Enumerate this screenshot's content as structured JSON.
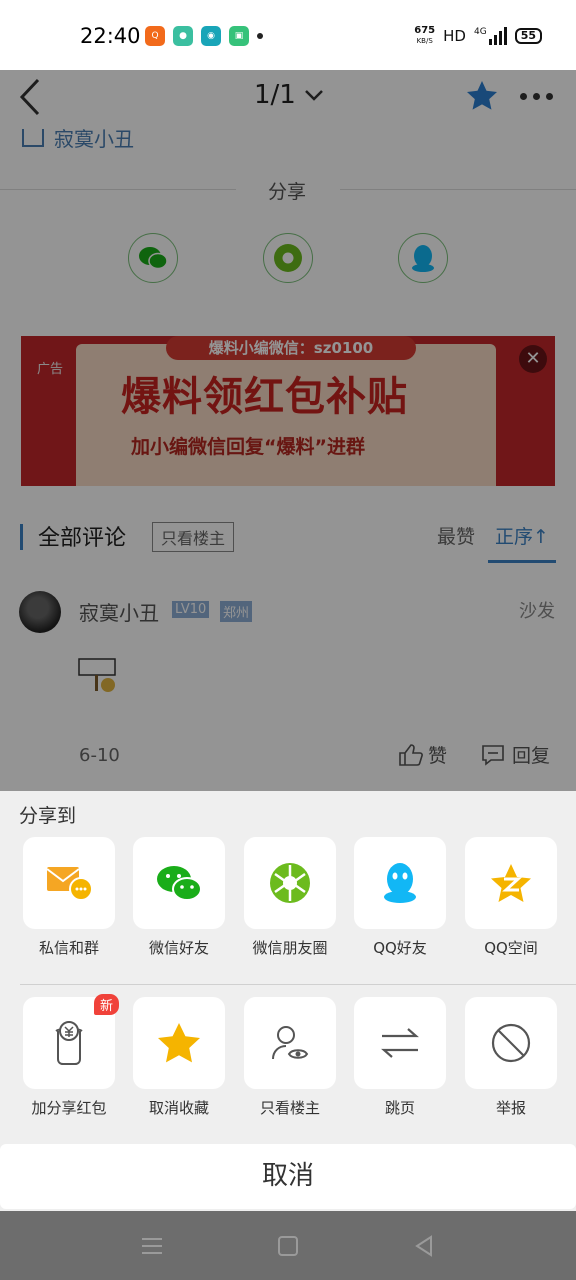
{
  "status_bar": {
    "time": "22:40",
    "net_speed": "675",
    "net_unit": "KB/S",
    "hd": "HD",
    "network": "4G",
    "battery": "55"
  },
  "app_bar": {
    "page_indicator": "1/1"
  },
  "post": {
    "author_snippet": "寂寞小丑",
    "share_title": "分享"
  },
  "ad": {
    "label": "广告",
    "pill": "爆料小编微信：sz0100",
    "headline": "爆料领红包补贴",
    "subline": "加小编微信回复“爆料”进群",
    "close": "✕"
  },
  "comments": {
    "title": "全部评论",
    "filter_tag": "只看楼主",
    "sort_hot": "最赞",
    "sort_order": "正序↑",
    "items": [
      {
        "name": "寂寞小丑",
        "level": "LV10",
        "location": "郑州",
        "floor": "沙发",
        "date": "6-10",
        "like": "赞",
        "reply": "回复"
      }
    ]
  },
  "share_sheet": {
    "title": "分享到",
    "row1": [
      {
        "label": "私信和群",
        "icon": "envelope-chat-icon"
      },
      {
        "label": "微信好友",
        "icon": "wechat-icon"
      },
      {
        "label": "微信朋友圈",
        "icon": "moments-icon"
      },
      {
        "label": "QQ好友",
        "icon": "qq-icon"
      },
      {
        "label": "QQ空间",
        "icon": "qzone-icon"
      }
    ],
    "row2": [
      {
        "label": "加分享红包",
        "icon": "red-packet-icon",
        "badge": "新"
      },
      {
        "label": "取消收藏",
        "icon": "star-icon"
      },
      {
        "label": "只看楼主",
        "icon": "eye-person-icon"
      },
      {
        "label": "跳页",
        "icon": "swap-arrows-icon"
      },
      {
        "label": "举报",
        "icon": "prohibit-icon"
      }
    ],
    "cancel": "取消"
  },
  "colors": {
    "accent": "#3b82c4",
    "wechat": "#1aad19",
    "qq": "#12b7f5",
    "qzone": "#f5b400",
    "star": "#f5b400",
    "badge": "#f0423a"
  }
}
